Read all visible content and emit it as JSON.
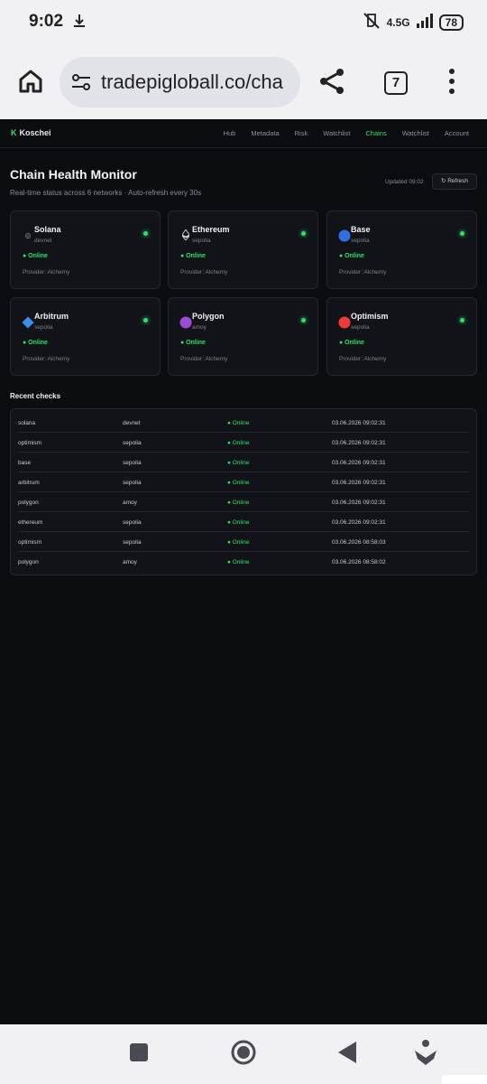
{
  "status_bar": {
    "time": "9:02",
    "network": "4.5G",
    "battery": "78"
  },
  "browser": {
    "url": "tradepigloball.co/cha",
    "tab_count": "7"
  },
  "app": {
    "logo_letter": "K",
    "logo_name": "Koschei",
    "nav": [
      "Hub",
      "Metadata",
      "Risk",
      "Watchlist",
      "Chains",
      "Watchlist",
      "Account"
    ],
    "active_nav": "Chains"
  },
  "header": {
    "title": "Chain Health Monitor",
    "subtitle": "Real-time status across 6 networks · Auto-refresh every 30s",
    "updated": "Updated 09:02",
    "refresh_label": "↻ Refresh"
  },
  "chains": [
    {
      "name": "Solana",
      "network": "devnet",
      "status": "● Online",
      "provider": "Provider: Alchemy",
      "icon": "solana-icon",
      "icon_color": "#9a9aa4"
    },
    {
      "name": "Ethereum",
      "network": "sepolia",
      "status": "● Online",
      "provider": "Provider: Alchemy",
      "icon": "ethereum-icon",
      "icon_color": "#d8d8de"
    },
    {
      "name": "Base",
      "network": "sepolia",
      "status": "● Online",
      "provider": "Provider: Alchemy",
      "icon": "base-icon",
      "icon_color": "#2f6fe0"
    },
    {
      "name": "Arbitrum",
      "network": "sepolia",
      "status": "● Online",
      "provider": "Provider: Alchemy",
      "icon": "arbitrum-icon",
      "icon_color": "#3b8ef0"
    },
    {
      "name": "Polygon",
      "network": "amoy",
      "status": "● Online",
      "provider": "Provider: Alchemy",
      "icon": "polygon-icon",
      "icon_color": "#9b4bd6"
    },
    {
      "name": "Optimism",
      "network": "sepolia",
      "status": "● Online",
      "provider": "Provider: Alchemy",
      "icon": "optimism-icon",
      "icon_color": "#f03a3a"
    }
  ],
  "recent": {
    "title": "Recent checks",
    "rows": [
      {
        "chain": "solana",
        "network": "devnet",
        "status": "● Online",
        "time": "03.06.2026 09:02:31"
      },
      {
        "chain": "optimism",
        "network": "sepolia",
        "status": "● Online",
        "time": "03.06.2026 09:02:31"
      },
      {
        "chain": "base",
        "network": "sepolia",
        "status": "● Online",
        "time": "03.06.2026 09:02:31"
      },
      {
        "chain": "arbitrum",
        "network": "sepolia",
        "status": "● Online",
        "time": "03.06.2026 09:02:31"
      },
      {
        "chain": "polygon",
        "network": "amoy",
        "status": "● Online",
        "time": "03.06.2026 09:02:31"
      },
      {
        "chain": "ethereum",
        "network": "sepolia",
        "status": "● Online",
        "time": "03.06.2026 09:02:31"
      },
      {
        "chain": "optimism",
        "network": "sepolia",
        "status": "● Online",
        "time": "03.06.2026 08:58:03"
      },
      {
        "chain": "polygon",
        "network": "amoy",
        "status": "● Online",
        "time": "03.06.2026 08:58:02"
      }
    ]
  },
  "colors": {
    "accent": "#2ee06a",
    "background": "#0b0c10",
    "card": "#121318"
  }
}
